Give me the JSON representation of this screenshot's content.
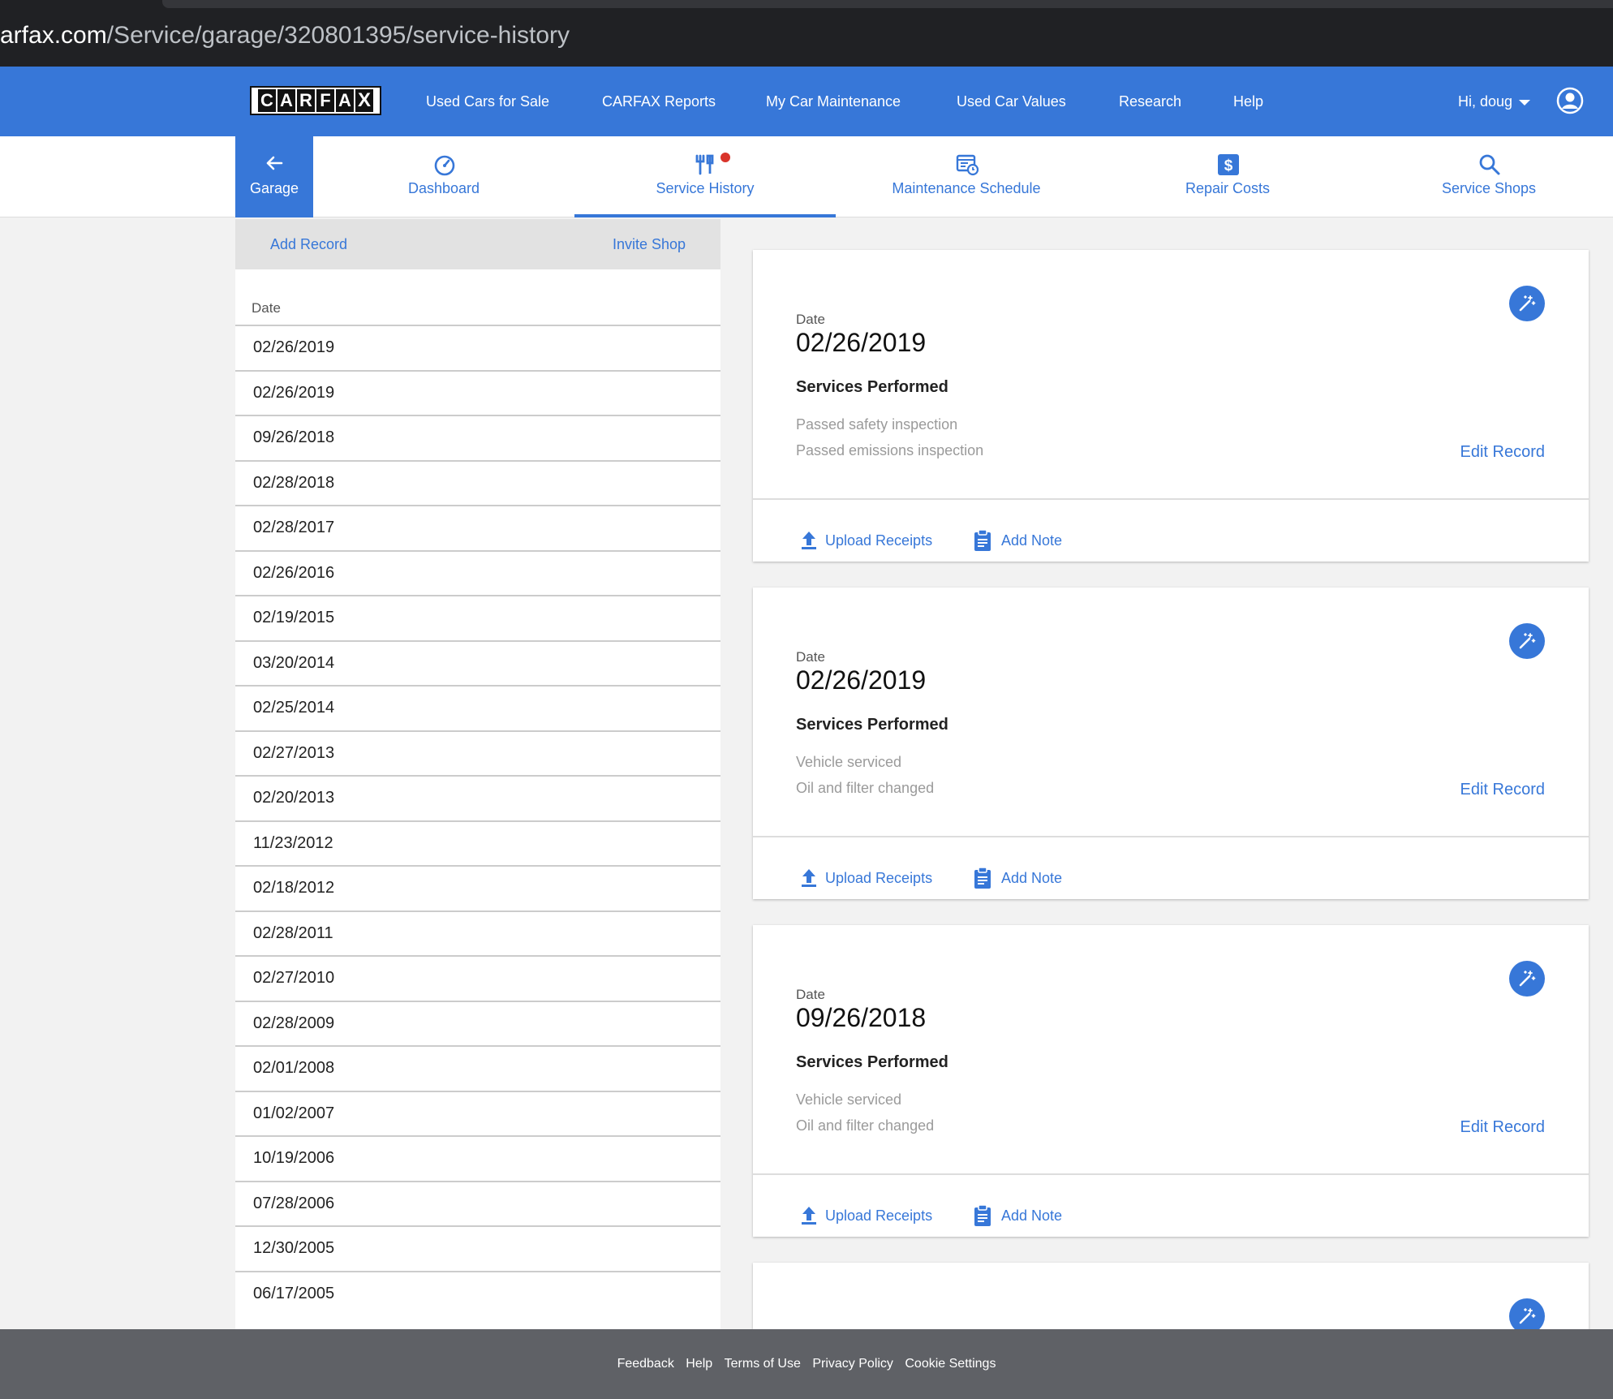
{
  "browser": {
    "url_host": "arfax.com",
    "url_path": "/Service/garage/320801395/service-history"
  },
  "header": {
    "logo_letters": [
      "C",
      "A",
      "R",
      "F",
      "A",
      "X"
    ],
    "nav": [
      "Used Cars for Sale",
      "CARFAX Reports",
      "My Car Maintenance",
      "Used Car Values",
      "Research",
      "Help"
    ],
    "user_greeting": "Hi, doug",
    "brand_color": "#3777d8"
  },
  "subnav": {
    "back_label": "Garage",
    "tabs": [
      {
        "label": "Dashboard",
        "icon": "speedometer-icon"
      },
      {
        "label": "Service History",
        "icon": "tools-icon",
        "active": true
      },
      {
        "label": "Maintenance Schedule",
        "icon": "calendar-clock-icon"
      },
      {
        "label": "Repair Costs",
        "icon": "dollar-icon"
      },
      {
        "label": "Service Shops",
        "icon": "search-icon"
      }
    ]
  },
  "sidebar": {
    "add_record": "Add Record",
    "invite_shop": "Invite Shop",
    "date_header": "Date",
    "dates": [
      "02/26/2019",
      "02/26/2019",
      "09/26/2018",
      "02/28/2018",
      "02/28/2017",
      "02/26/2016",
      "02/19/2015",
      "03/20/2014",
      "02/25/2014",
      "02/27/2013",
      "02/20/2013",
      "11/23/2012",
      "02/18/2012",
      "02/28/2011",
      "02/27/2010",
      "02/28/2009",
      "02/01/2008",
      "01/02/2007",
      "10/19/2006",
      "07/28/2006",
      "12/30/2005",
      "06/17/2005"
    ]
  },
  "records": [
    {
      "date_label": "Date",
      "date": "02/26/2019",
      "services_title": "Services Performed",
      "services": [
        "Passed safety inspection",
        "Passed emissions inspection"
      ],
      "edit": "Edit Record",
      "upload": "Upload Receipts",
      "note": "Add Note"
    },
    {
      "date_label": "Date",
      "date": "02/26/2019",
      "services_title": "Services Performed",
      "services": [
        "Vehicle serviced",
        "Oil and filter changed"
      ],
      "edit": "Edit Record",
      "upload": "Upload Receipts",
      "note": "Add Note"
    },
    {
      "date_label": "Date",
      "date": "09/26/2018",
      "services_title": "Services Performed",
      "services": [
        "Vehicle serviced",
        "Oil and filter changed"
      ],
      "edit": "Edit Record",
      "upload": "Upload Receipts",
      "note": "Add Note"
    }
  ],
  "footer": [
    "Feedback",
    "Help",
    "Terms of Use",
    "Privacy Policy",
    "Cookie Settings"
  ]
}
